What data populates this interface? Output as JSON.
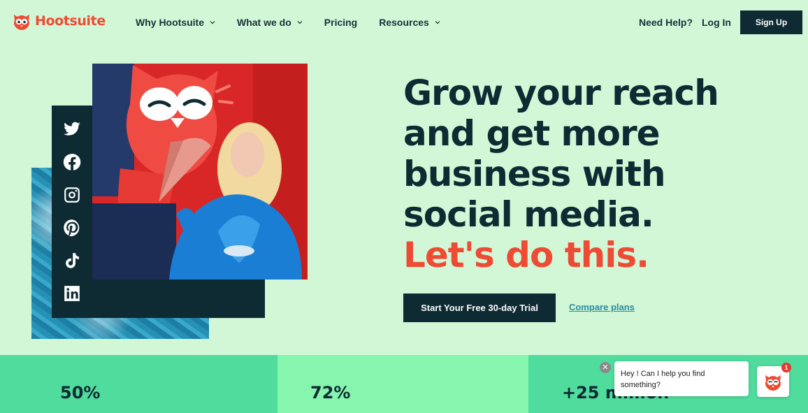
{
  "header": {
    "logo_text": "Hootsuite",
    "menu": [
      {
        "label": "Why Hootsuite",
        "has_dropdown": true
      },
      {
        "label": "What we do",
        "has_dropdown": true
      },
      {
        "label": "Pricing",
        "has_dropdown": false
      },
      {
        "label": "Resources",
        "has_dropdown": true
      }
    ],
    "help_label": "Need Help?",
    "login_label": "Log In",
    "signup_label": "Sign Up"
  },
  "hero": {
    "headline_lines": [
      "Grow your reach",
      "and get more",
      "business with",
      "social media."
    ],
    "headline_accent": "Let's do this.",
    "cta_label": "Start Your Free 30-day Trial",
    "compare_label": "Compare plans",
    "social_icons": [
      "twitter-icon",
      "facebook-icon",
      "instagram-icon",
      "pinterest-icon",
      "tiktok-icon",
      "linkedin-icon"
    ]
  },
  "stats": [
    {
      "value": "50%"
    },
    {
      "value": "72%"
    },
    {
      "value": "+25 million"
    }
  ],
  "chat": {
    "message": "Hey ! Can I help you find something?",
    "badge_count": "1",
    "close_glyph": "✕"
  },
  "colors": {
    "background": "#d2f7d6",
    "brand_red": "#ee4b35",
    "navy": "#0e2a33",
    "stat_green": "#4fdc9c",
    "stat_light_green": "#86f5ad"
  }
}
